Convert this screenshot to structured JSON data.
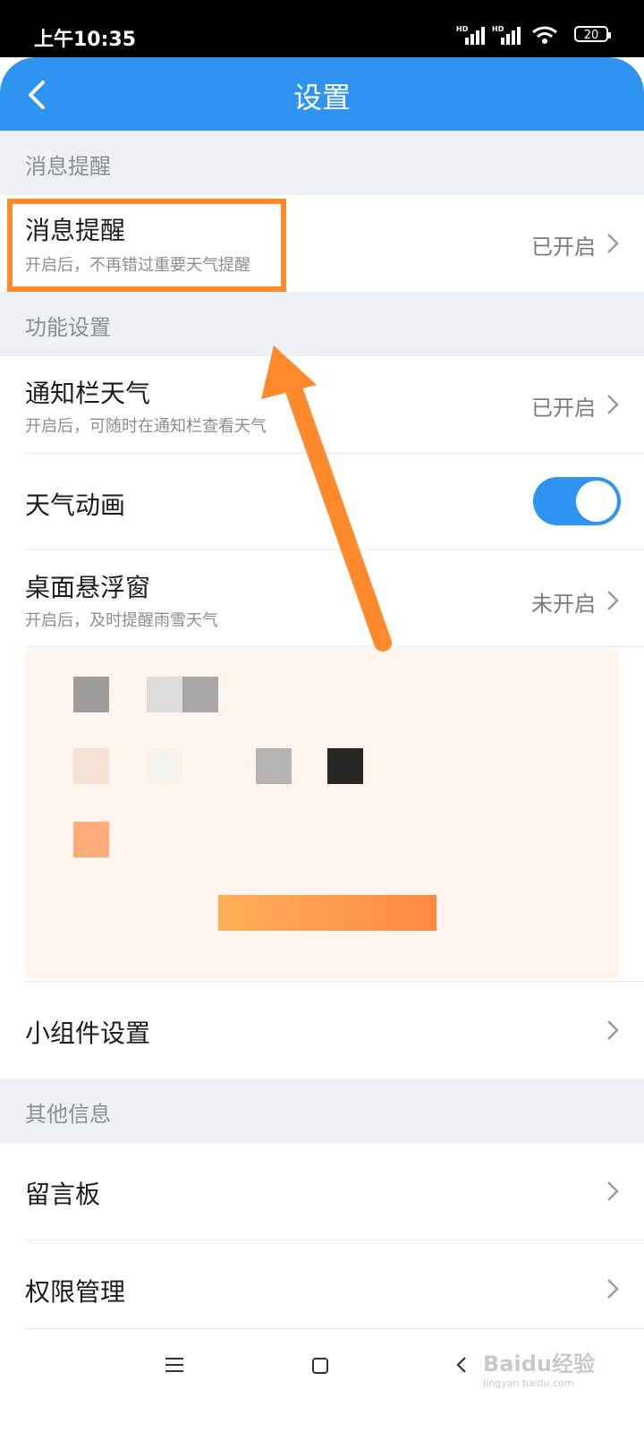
{
  "status_bar": {
    "time": "上午10:35",
    "network_label": "HD",
    "battery": "20"
  },
  "header": {
    "title": "设置",
    "back_icon": "chevron-left-icon"
  },
  "sections": {
    "msg": "消息提醒",
    "func": "功能设置",
    "other": "其他信息"
  },
  "rows": {
    "msg_reminder": {
      "title": "消息提醒",
      "subtitle": "开启后，不再错过重要天气提醒",
      "status": "已开启"
    },
    "notif_weather": {
      "title": "通知栏天气",
      "subtitle": "开启后，可随时在通知栏查看天气",
      "status": "已开启"
    },
    "weather_anim": {
      "title": "天气动画",
      "enabled": true
    },
    "float_window": {
      "title": "桌面悬浮窗",
      "subtitle": "开启后，及时提醒雨雪天气",
      "status": "未开启"
    },
    "widget": {
      "title": "小组件设置"
    },
    "board": {
      "title": "留言板"
    },
    "perm": {
      "title": "权限管理"
    }
  },
  "watermark": {
    "brand": "Baidu经验",
    "url": "jingyan.baidu.com"
  },
  "colors": {
    "accent": "#2f94f1",
    "highlight": "#ff8a2b",
    "section_bg": "#edf1f5"
  }
}
